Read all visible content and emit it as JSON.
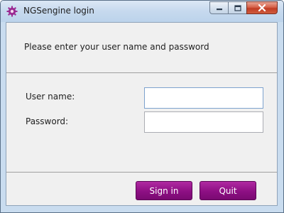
{
  "window": {
    "title": "NGSengine login",
    "app_icon": "gear-icon",
    "controls": {
      "minimize": "minimize-icon",
      "maximize": "maximize-icon",
      "close": "close-icon"
    }
  },
  "login": {
    "prompt": "Please enter your user name and password",
    "username_label": "User name:",
    "username_value": "",
    "password_label": "Password:",
    "password_value": ""
  },
  "buttons": {
    "signin_label": "Sign in",
    "quit_label": "Quit"
  },
  "colors": {
    "accent": "#8d0f83",
    "titlebar": "#c6d9ee",
    "close_button": "#c13d25"
  }
}
